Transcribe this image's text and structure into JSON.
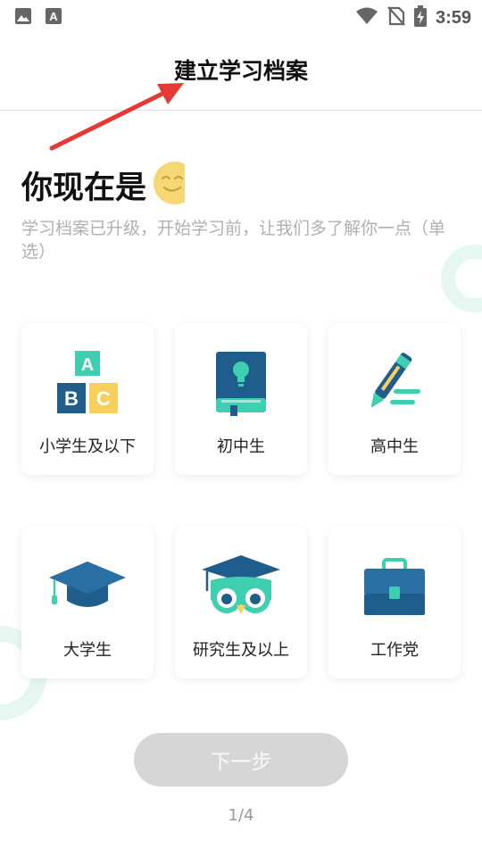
{
  "status_bar": {
    "time": "3:59",
    "icons": [
      "gallery-icon",
      "keyboard-a-icon",
      "wifi-icon",
      "no-sim-icon",
      "battery-charging-icon"
    ]
  },
  "header": {
    "title": "建立学习档案"
  },
  "question": {
    "title": "你现在是",
    "subtitle": "学习档案已升级，开始学习前，让我们多了解你一点（单选）",
    "emoji_icon": "smiling-face-icon"
  },
  "options": [
    {
      "label": "小学生及以下",
      "icon": "abc-blocks-icon"
    },
    {
      "label": "初中生",
      "icon": "lightbulb-book-icon"
    },
    {
      "label": "高中生",
      "icon": "pen-writing-icon"
    },
    {
      "label": "大学生",
      "icon": "graduation-cap-icon"
    },
    {
      "label": "研究生及以上",
      "icon": "owl-scholar-icon"
    },
    {
      "label": "工作党",
      "icon": "briefcase-icon"
    }
  ],
  "footer": {
    "next_label": "下一步",
    "page_indicator": "1/4"
  },
  "colors": {
    "accent_teal": "#3ecfb0",
    "navy": "#1f5d8c",
    "yellow": "#f7cf5b",
    "annotation_red": "#e53935",
    "button_disabled": "#d6d6d6"
  }
}
